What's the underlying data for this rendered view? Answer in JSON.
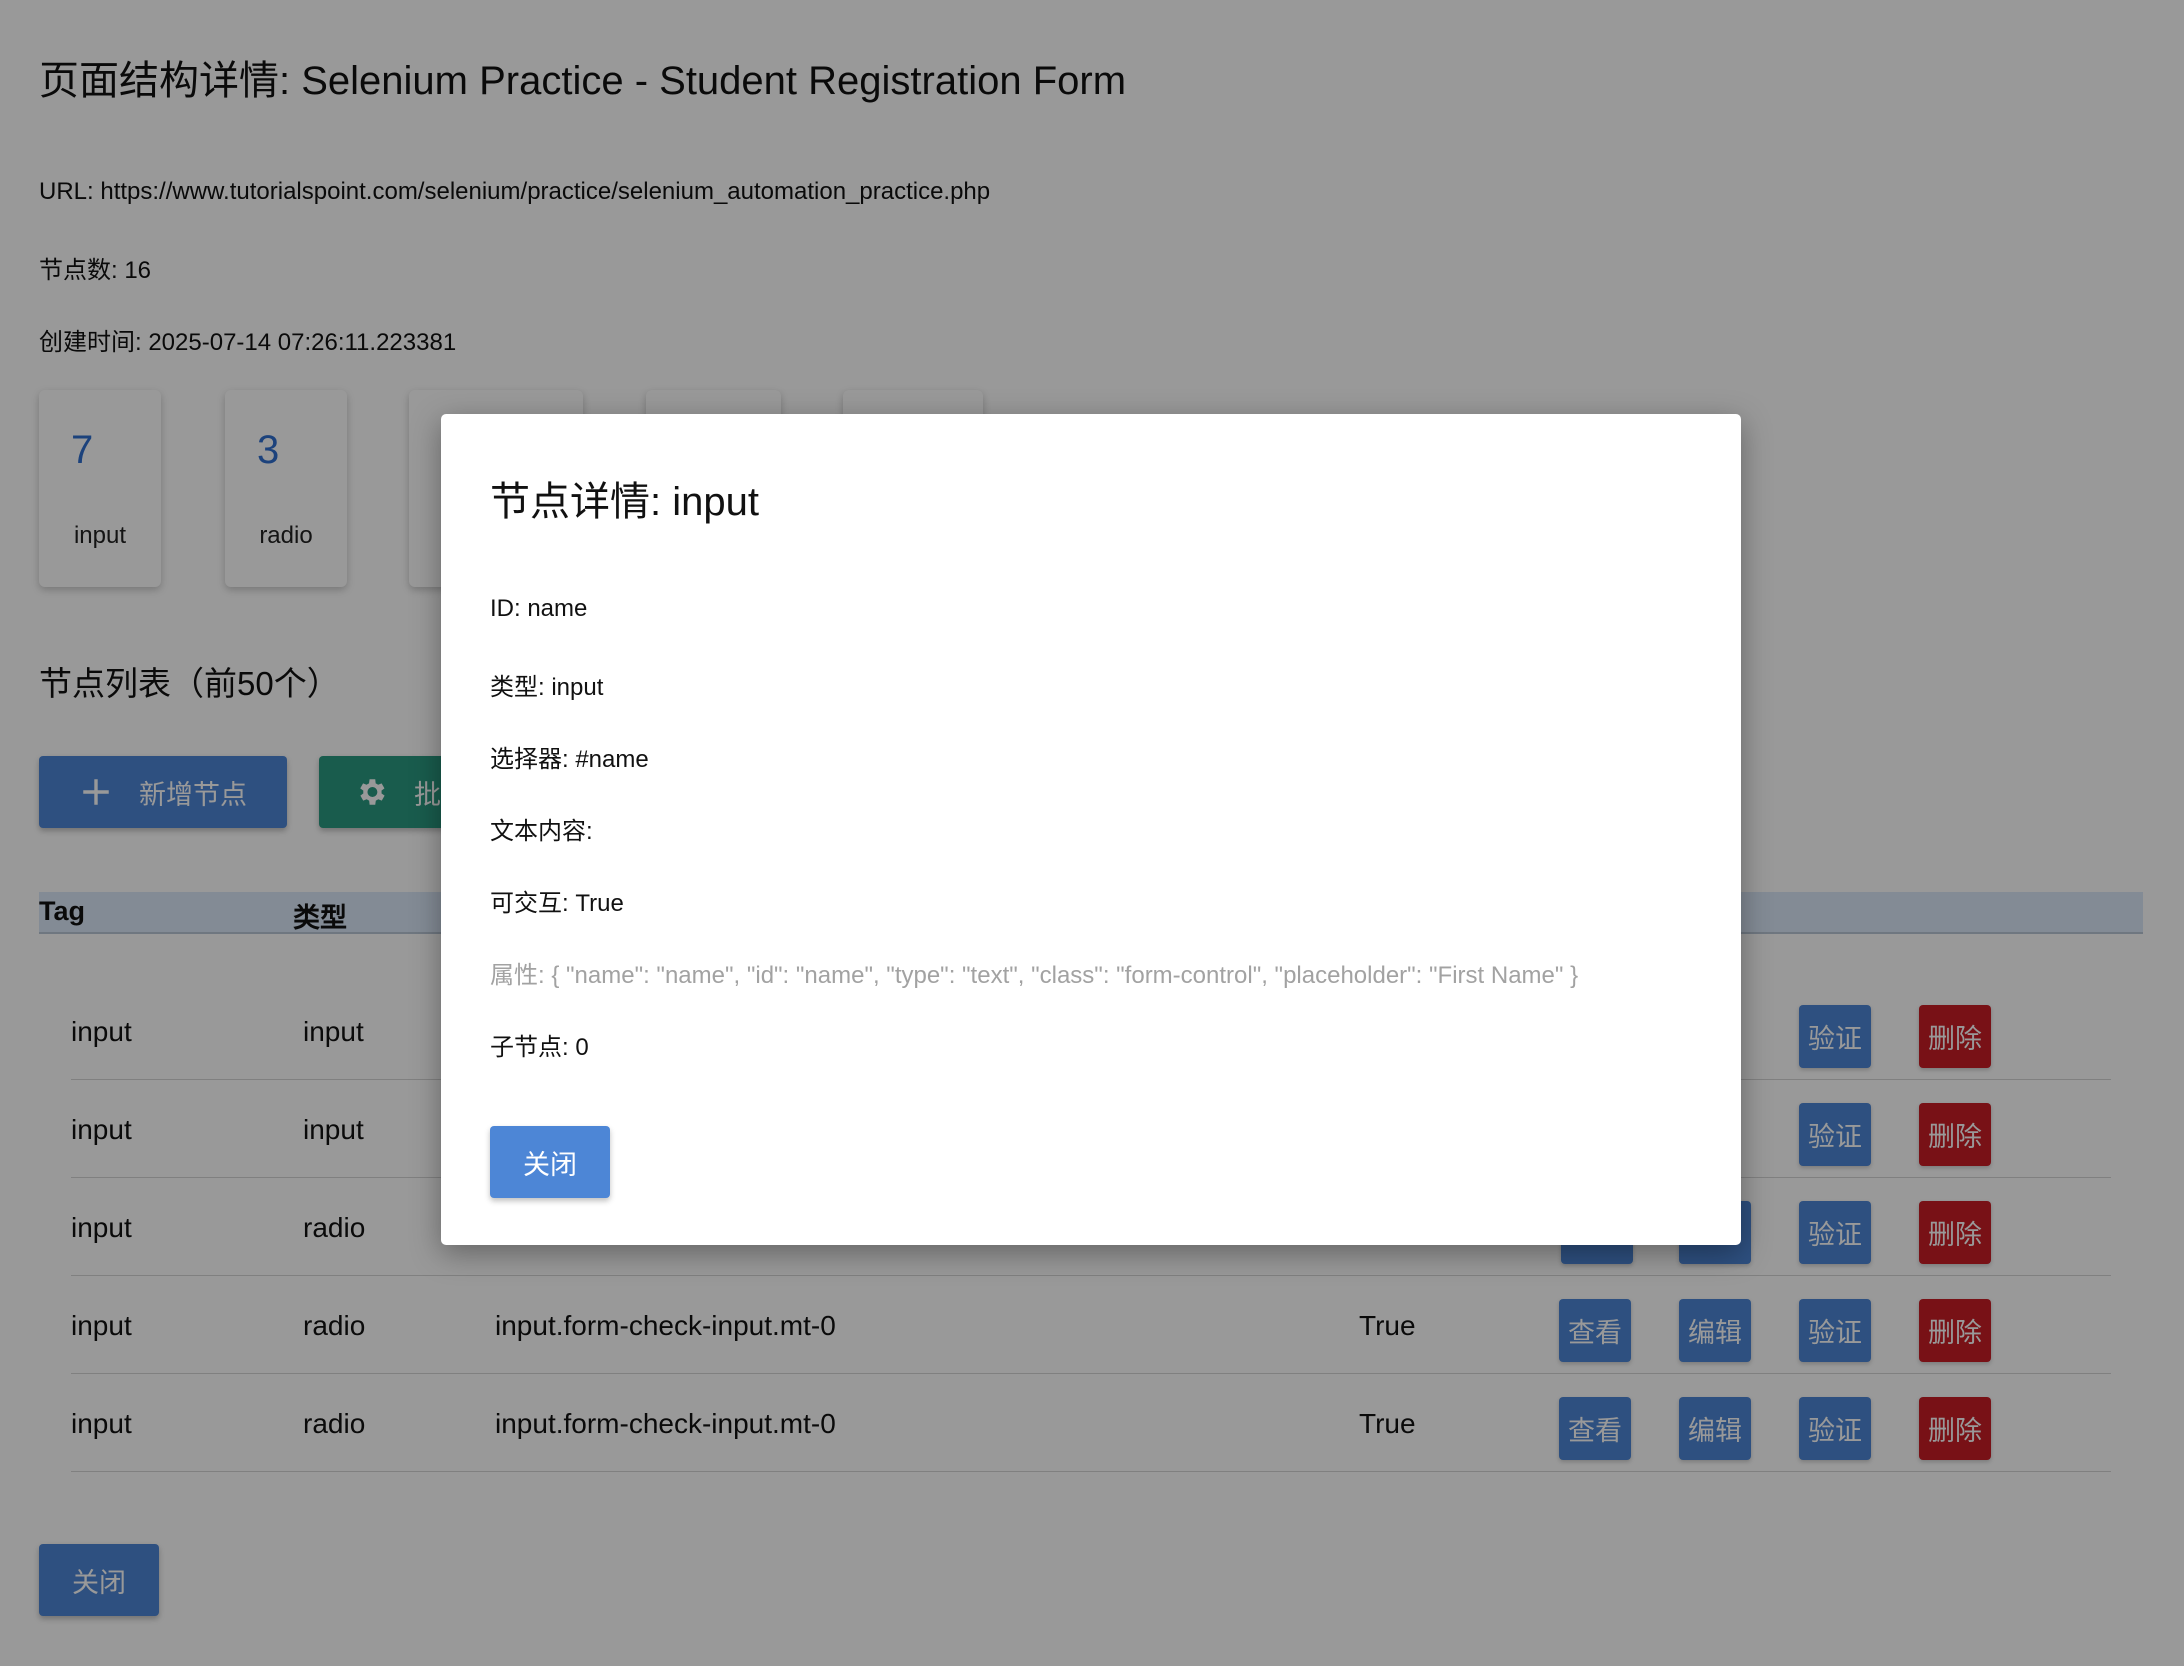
{
  "page": {
    "title": "页面结构详情: Selenium Practice - Student Registration Form",
    "url_line": "URL: https://www.tutorialspoint.com/selenium/practice/selenium_automation_practice.php",
    "node_count_line": "节点数: 16",
    "created_line": "创建时间: 2025-07-14 07:26:11.223381"
  },
  "stats": [
    {
      "count": "7",
      "label": "input"
    },
    {
      "count": "3",
      "label": "radio"
    }
  ],
  "node_list": {
    "title": "节点列表（前50个）",
    "add_button": "新增节点",
    "batch_button": "批",
    "columns": {
      "tag": "Tag",
      "type": "类型"
    },
    "rows": [
      {
        "tag": "input",
        "type": "input"
      },
      {
        "tag": "input",
        "type": "input"
      },
      {
        "tag": "input",
        "type": "radio"
      },
      {
        "tag": "input",
        "type": "radio",
        "selector": "input.form-check-input.mt-0",
        "interactive": "True"
      },
      {
        "tag": "input",
        "type": "radio",
        "selector": "input.form-check-input.mt-0",
        "interactive": "True"
      }
    ],
    "row_actions": {
      "view": "查看",
      "edit": "编辑",
      "verify": "验证",
      "delete": "删除"
    }
  },
  "close_button": "关闭",
  "modal": {
    "title": "节点详情: input",
    "id_line": "ID: name",
    "type_line": "类型: input",
    "selector_line": "选择器: #name",
    "text_line": "文本内容:",
    "interactive_line": "可交互: True",
    "attributes_line": "属性: { \"name\": \"name\", \"id\": \"name\", \"type\": \"text\", \"class\": \"form-control\", \"placeholder\": \"First Name\" }",
    "children_line": "子节点: 0",
    "close_button": "关闭"
  },
  "colors": {
    "primary": "#4d86d6",
    "success": "#2b9a80",
    "danger": "#c81d25",
    "stat_count": "#2f6fcf",
    "overlay": "rgba(0,0,0,0.4)"
  },
  "icons": {
    "add": "plus-icon",
    "batch": "gear-icon"
  }
}
